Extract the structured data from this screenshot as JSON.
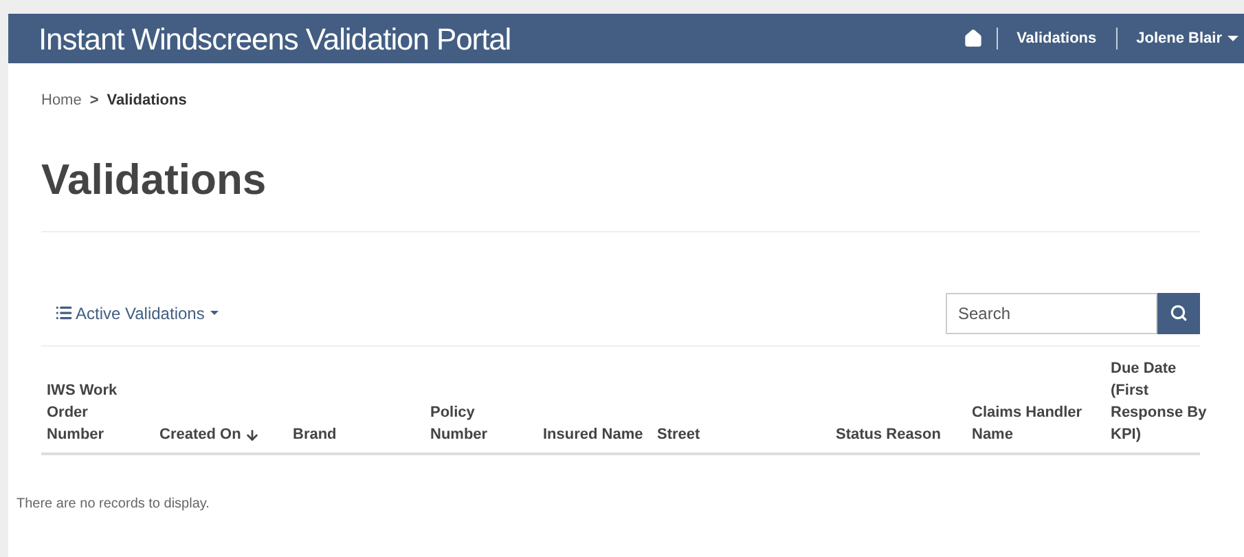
{
  "navbar": {
    "title": "Instant Windscreens Validation Portal",
    "links": [
      {
        "label": "Validations"
      }
    ],
    "user": {
      "label": "Jolene Blair"
    }
  },
  "breadcrumb": [
    {
      "label": "Home",
      "current": false
    },
    {
      "label": "Validations",
      "current": true
    }
  ],
  "breadcrumb_separator": ">",
  "page_title": "Validations",
  "view_selector": {
    "label": "Active Validations"
  },
  "search": {
    "placeholder": "Search"
  },
  "table": {
    "columns": [
      {
        "label": "IWS Work Order Number",
        "sorted": false
      },
      {
        "label": "Created On",
        "sorted": true
      },
      {
        "label": "Brand",
        "sorted": false
      },
      {
        "label": "Policy Number",
        "sorted": false
      },
      {
        "label": "Insured Name",
        "sorted": false
      },
      {
        "label": "Street",
        "sorted": false
      },
      {
        "label": "Status Reason",
        "sorted": false
      },
      {
        "label": "Claims Handler Name",
        "sorted": false
      },
      {
        "label": "Due Date (First Response By KPI)",
        "sorted": false
      }
    ],
    "empty_message": "There are no records to display."
  }
}
